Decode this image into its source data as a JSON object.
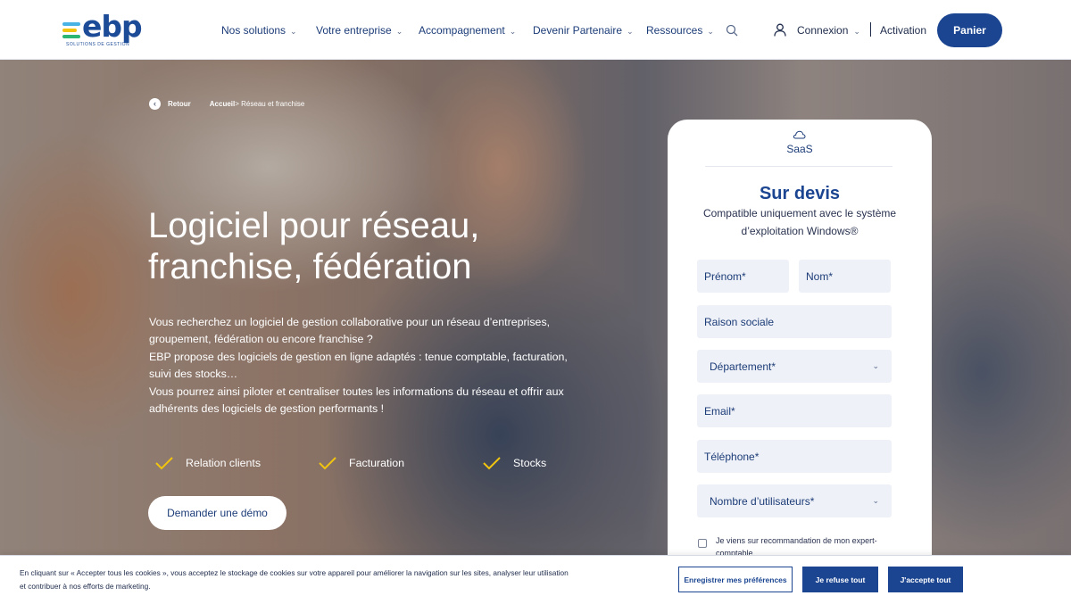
{
  "header": {
    "logo_text": "ebp",
    "logo_tagline": "SOLUTIONS DE GESTION",
    "nav": [
      {
        "label": "Nos solutions"
      },
      {
        "label": "Votre entreprise"
      },
      {
        "label": "Accompagnement"
      },
      {
        "label": "Devenir Partenaire"
      },
      {
        "label": "Ressources"
      }
    ],
    "connexion_label": "Connexion",
    "activation_label": "Activation",
    "panier_label": "Panier"
  },
  "hero": {
    "breadcrumb": {
      "back": "Retour",
      "home": "Accueil",
      "current": " > Réseau et franchise"
    },
    "title_line1": "Logiciel pour réseau,",
    "title_line2": "franchise, fédération",
    "paragraphs": [
      "Vous recherchez un logiciel de gestion collaborative pour un réseau d’entreprises, groupement, fédération ou encore franchise ?",
      "EBP propose des logiciels de gestion en ligne adaptés : tenue comptable, facturation, suivi des stocks…",
      "Vous pourrez ainsi piloter et centraliser toutes les informations du réseau et offrir aux adhérents des logiciels de gestion performants !"
    ],
    "features": [
      "Relation clients",
      "Facturation",
      "Stocks"
    ],
    "demo_button": "Demander une démo"
  },
  "form": {
    "tab_label": "SaaS",
    "price_title": "Sur devis",
    "compat_line1": "Compatible uniquement avec le système",
    "compat_line2": "d’exploitation Windows®",
    "prenom": "Prénom*",
    "nom": "Nom*",
    "raison_sociale": "Raison sociale",
    "departement": "Département*",
    "email": "Email*",
    "telephone": "Téléphone*",
    "nb_utilisateurs": "Nombre d’utilisateurs*",
    "reco_text": "Je viens sur recommandation de mon expert-comptable"
  },
  "cookie": {
    "text": "En cliquant sur « Accepter tous les cookies », vous acceptez le stockage de cookies sur votre appareil pour améliorer la navigation sur les sites, analyser leur utilisation et contribuer à nos efforts de marketing.",
    "pref_button": "Enregistrer mes préférences",
    "refuse_button": "Je refuse tout",
    "accept_button": "J'accepte tout"
  },
  "colors": {
    "brand_blue": "#1b4591",
    "check_yellow": "#f1c40f",
    "field_bg": "#eef1f7"
  },
  "icons": {
    "search": "search-icon",
    "user": "user-icon",
    "cloud": "cloud-icon",
    "check": "check-icon",
    "back": "arrow-left-icon"
  }
}
